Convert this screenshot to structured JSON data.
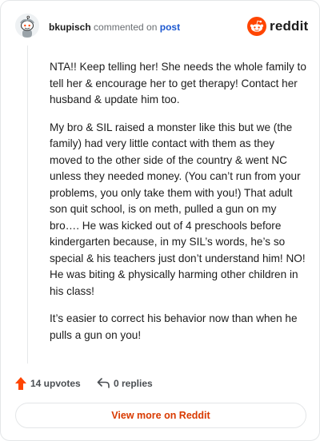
{
  "header": {
    "username": "bkupisch",
    "action": " commented on ",
    "post_link": "post",
    "brand": "reddit",
    "avatar_icon": "snoo-avatar-icon",
    "brand_icon": "reddit-logo-icon"
  },
  "comment": {
    "paragraphs": [
      "NTA!! Keep telling her! She needs the whole family to tell her & encourage her to get therapy! Contact her husband & update him too.",
      "My bro & SIL raised a monster like this but we (the family) had very little contact with them as they moved to the other side of the country & went NC unless they needed money. (You can’t run from your problems, you only take them with you!) That adult son quit school, is on meth, pulled a gun on my bro…. He was kicked out of 4 preschools before kindergarten because, in my SIL’s words, he’s so special & his teachers just don’t understand him! NO! He was biting & physically harming other children in his class!",
      "It’s easier to correct his behavior now than when he pulls a gun on you!"
    ]
  },
  "footer": {
    "upvotes": "14 upvotes",
    "replies": "0 replies",
    "view_more": "View more on Reddit"
  },
  "colors": {
    "accent": "#ff4500",
    "link": "#1c58d0",
    "cta": "#d93a00"
  }
}
